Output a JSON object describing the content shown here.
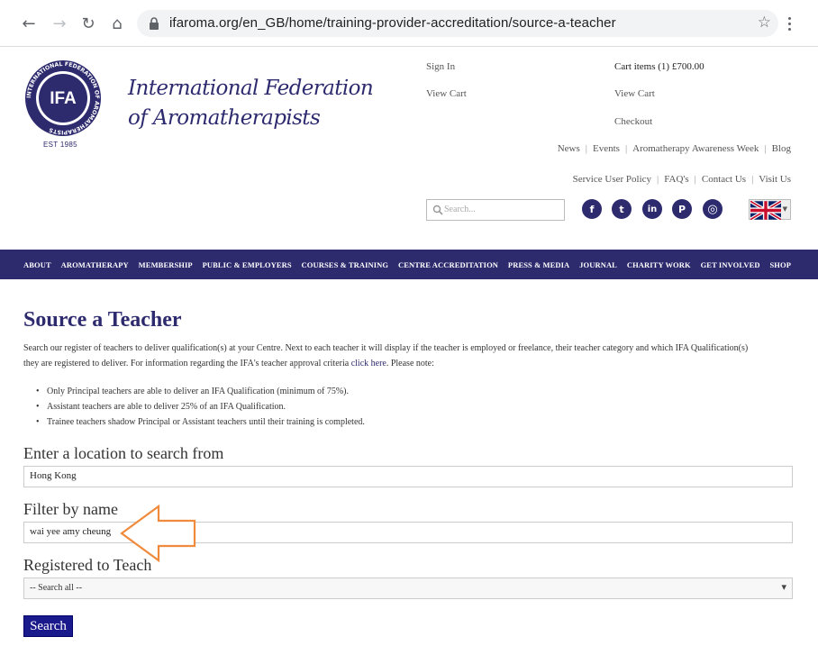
{
  "browser": {
    "url": "ifaroma.org/en_GB/home/training-provider-accreditation/source-a-teacher",
    "back_icon": "←",
    "forward_icon": "→",
    "reload_icon": "↻",
    "home_icon": "⌂",
    "star_icon": "☆"
  },
  "header": {
    "logo_text": "IFA",
    "logo_ring_text": "INTERNATIONAL FEDERATION OF AROMATHERAPISTS",
    "logo_est": "EST 1985",
    "org_line1": "International Federation",
    "org_line2": "of Aromatherapists",
    "sign_in": "Sign In",
    "view_cart_left": "View Cart",
    "cart_items": "Cart items (1) £700.00",
    "view_cart_right": "View Cart",
    "checkout": "Checkout",
    "links_row1": [
      "News",
      "Events",
      "Aromatherapy Awareness Week",
      "Blog"
    ],
    "links_row2": [
      "Service User Policy",
      "FAQ's",
      "Contact Us",
      "Visit Us"
    ],
    "search_placeholder": "Search...",
    "social": [
      {
        "name": "facebook-icon",
        "glyph": "f"
      },
      {
        "name": "twitter-icon",
        "glyph": "t"
      },
      {
        "name": "linkedin-icon",
        "glyph": "in"
      },
      {
        "name": "pinterest-icon",
        "glyph": "P"
      },
      {
        "name": "instagram-icon",
        "glyph": "◎"
      }
    ],
    "language_flag": "uk-flag-icon"
  },
  "nav": [
    "ABOUT",
    "AROMATHERAPY",
    "MEMBERSHIP",
    "PUBLIC & EMPLOYERS",
    "COURSES & TRAINING",
    "CENTRE ACCREDITATION",
    "PRESS & MEDIA",
    "JOURNAL",
    "CHARITY WORK",
    "GET INVOLVED",
    "SHOP"
  ],
  "content": {
    "title": "Source a Teacher",
    "intro_a": "Search our register of teachers to deliver qualification(s) at your Centre. Next to each teacher it will display if the teacher is employed or freelance, their teacher category and which IFA Qualification(s) they are registered to deliver. For information regarding the IFA's teacher approval criteria ",
    "intro_link": "click here",
    "intro_b": ". Please note:",
    "bullets": [
      "Only Principal teachers are able to deliver an IFA Qualification (minimum of 75%).",
      "Assistant teachers are able to deliver 25% of an IFA Qualification.",
      "Trainee teachers shadow Principal or Assistant teachers until their training is completed."
    ],
    "location_label": "Enter a location to search from",
    "location_value": "Hong Kong",
    "name_label": "Filter by name",
    "name_value": "wai yee amy cheung",
    "registered_label": "Registered to Teach",
    "registered_selected": "-- Search all --",
    "search_button": "Search"
  },
  "colors": {
    "brand": "#2d2a6e",
    "button": "#1a1a8c",
    "annotation": "#f08a3c"
  }
}
